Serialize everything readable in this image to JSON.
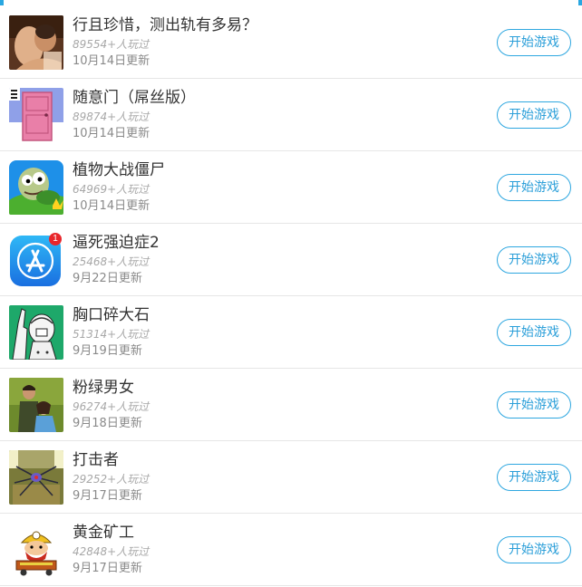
{
  "games": [
    {
      "icon": "romance-couple-icon",
      "title": "行且珍惜，测出轨有多易？",
      "plays": "89554+人玩过",
      "date": "10月14日更新",
      "button": "开始游戏"
    },
    {
      "icon": "pink-door-icon",
      "title": "随意门（屌丝版）",
      "plays": "89874+人玩过",
      "date": "10月14日更新",
      "button": "开始游戏"
    },
    {
      "icon": "zombie-icon",
      "title": "植物大战僵尸",
      "plays": "64969+人玩过",
      "date": "10月14日更新",
      "button": "开始游戏"
    },
    {
      "icon": "app-store-icon",
      "title": "逼死强迫症2",
      "plays": "25468+人玩过",
      "date": "9月22日更新",
      "button": "开始游戏",
      "badge": "1"
    },
    {
      "icon": "cartoon-hand-icon",
      "title": "胸口碎大石",
      "plays": "51314+人玩过",
      "date": "9月19日更新",
      "button": "开始游戏"
    },
    {
      "icon": "couple-photo-icon",
      "title": "粉绿男女",
      "plays": "96274+人玩过",
      "date": "9月18日更新",
      "button": "开始游戏"
    },
    {
      "icon": "striker-spider-icon",
      "title": "打击者",
      "plays": "29252+人玩过",
      "date": "9月17日更新",
      "button": "开始游戏"
    },
    {
      "icon": "gold-miner-icon",
      "title": "黄金矿工",
      "plays": "42848+人玩过",
      "date": "9月17日更新",
      "button": "开始游戏"
    }
  ],
  "colors": {
    "accent": "#2ea7e0",
    "badge": "#e8262b",
    "divider": "#e6e6e6"
  }
}
